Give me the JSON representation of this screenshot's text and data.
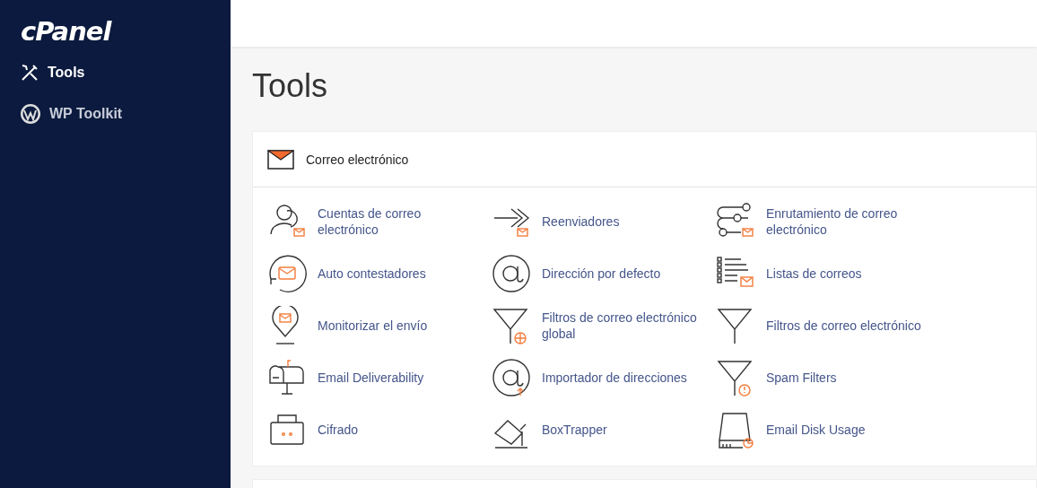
{
  "logo": "cPanel",
  "sidebar": {
    "items": [
      {
        "label": "Tools",
        "kind": "tools",
        "selected": true
      },
      {
        "label": "WP Toolkit",
        "kind": "wordpress",
        "selected": false
      }
    ]
  },
  "page_title": "Tools",
  "panel": {
    "title": "Correo electrónico",
    "items": [
      {
        "label": "Cuentas de correo electrónico",
        "kind": "user"
      },
      {
        "label": "Auto contestadores",
        "kind": "autoreply"
      },
      {
        "label": "Monitorizar el envío",
        "kind": "pin"
      },
      {
        "label": "Email Deliverability",
        "kind": "mailbox"
      },
      {
        "label": "Cifrado",
        "kind": "lock"
      },
      {
        "label": "Reenviadores",
        "kind": "forward"
      },
      {
        "label": "Dirección por defecto",
        "kind": "at"
      },
      {
        "label": "Filtros de correo electrónico global",
        "kind": "filter-globe"
      },
      {
        "label": "Importador de direcciones",
        "kind": "at-up"
      },
      {
        "label": "BoxTrapper",
        "kind": "trap"
      },
      {
        "label": "Enrutamiento de correo electrónico",
        "kind": "route"
      },
      {
        "label": "Listas de correos",
        "kind": "list"
      },
      {
        "label": "Filtros de correo electrónico",
        "kind": "filter"
      },
      {
        "label": "Spam Filters",
        "kind": "filter-alert"
      },
      {
        "label": "Email Disk Usage",
        "kind": "disk"
      }
    ]
  }
}
